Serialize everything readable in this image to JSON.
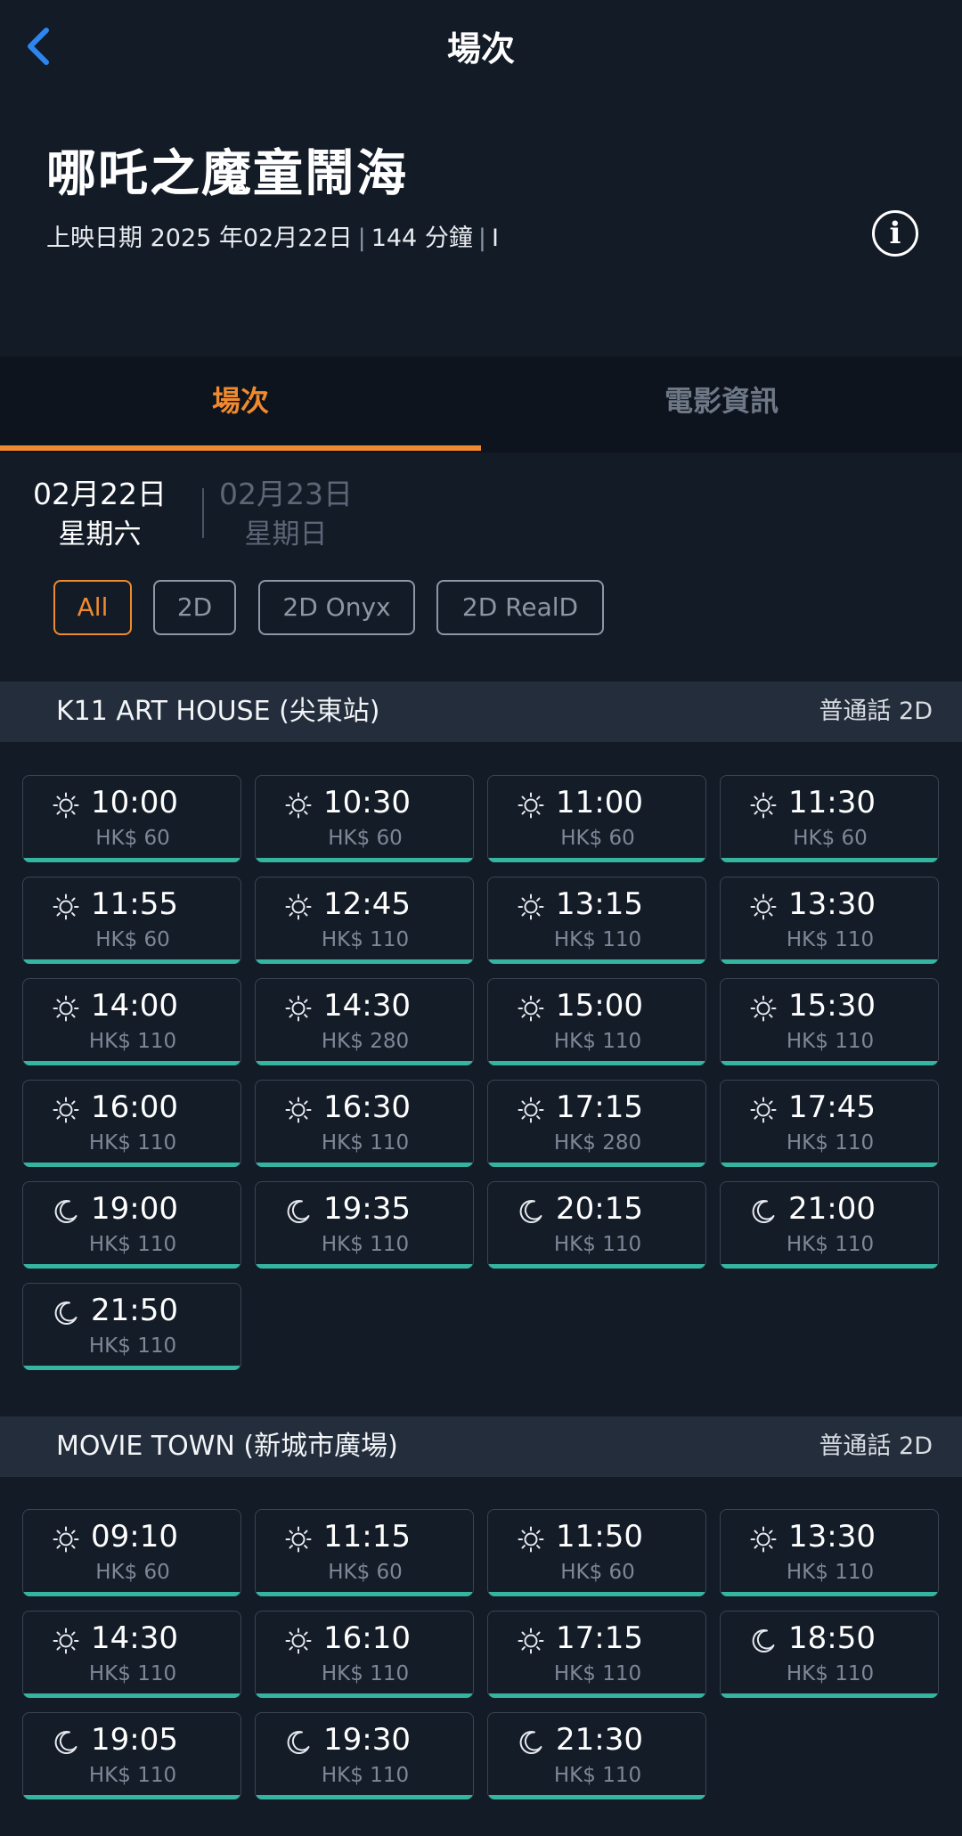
{
  "nav": {
    "title": "場次"
  },
  "movie": {
    "title": "哪吒之魔童鬧海",
    "release": "上映日期 2025 年02月22日",
    "duration": "144 分鐘",
    "rating": "I"
  },
  "tabs": [
    {
      "label": "場次"
    },
    {
      "label": "電影資訊"
    }
  ],
  "dates": [
    {
      "date": "02月22日",
      "weekday": "星期六"
    },
    {
      "date": "02月23日",
      "weekday": "星期日"
    }
  ],
  "filters": [
    {
      "label": "All"
    },
    {
      "label": "2D"
    },
    {
      "label": "2D Onyx"
    },
    {
      "label": "2D RealD"
    }
  ],
  "cinemas": [
    {
      "name": "K11 ART HOUSE (尖東站)",
      "lang": "普通話 2D",
      "showtimes": [
        {
          "time": "10:00",
          "price": "HK$ 60",
          "icon": "sun-icon"
        },
        {
          "time": "10:30",
          "price": "HK$ 60",
          "icon": "sun-icon"
        },
        {
          "time": "11:00",
          "price": "HK$ 60",
          "icon": "sun-icon"
        },
        {
          "time": "11:30",
          "price": "HK$ 60",
          "icon": "sun-icon"
        },
        {
          "time": "11:55",
          "price": "HK$ 60",
          "icon": "sun-icon"
        },
        {
          "time": "12:45",
          "price": "HK$ 110",
          "icon": "sun-icon"
        },
        {
          "time": "13:15",
          "price": "HK$ 110",
          "icon": "sun-icon"
        },
        {
          "time": "13:30",
          "price": "HK$ 110",
          "icon": "sun-icon"
        },
        {
          "time": "14:00",
          "price": "HK$ 110",
          "icon": "sun-icon"
        },
        {
          "time": "14:30",
          "price": "HK$ 280",
          "icon": "sun-icon"
        },
        {
          "time": "15:00",
          "price": "HK$ 110",
          "icon": "sun-icon"
        },
        {
          "time": "15:30",
          "price": "HK$ 110",
          "icon": "sun-icon"
        },
        {
          "time": "16:00",
          "price": "HK$ 110",
          "icon": "sun-icon"
        },
        {
          "time": "16:30",
          "price": "HK$ 110",
          "icon": "sun-icon"
        },
        {
          "time": "17:15",
          "price": "HK$ 280",
          "icon": "sun-icon"
        },
        {
          "time": "17:45",
          "price": "HK$ 110",
          "icon": "sun-icon"
        },
        {
          "time": "19:00",
          "price": "HK$ 110",
          "icon": "moon-icon"
        },
        {
          "time": "19:35",
          "price": "HK$ 110",
          "icon": "moon-icon"
        },
        {
          "time": "20:15",
          "price": "HK$ 110",
          "icon": "moon-icon"
        },
        {
          "time": "21:00",
          "price": "HK$ 110",
          "icon": "moon-icon"
        },
        {
          "time": "21:50",
          "price": "HK$ 110",
          "icon": "moon-icon"
        }
      ]
    },
    {
      "name": "MOVIE TOWN (新城市廣場)",
      "lang": "普通話 2D",
      "showtimes": [
        {
          "time": "09:10",
          "price": "HK$ 60",
          "icon": "sun-icon"
        },
        {
          "time": "11:15",
          "price": "HK$ 60",
          "icon": "sun-icon"
        },
        {
          "time": "11:50",
          "price": "HK$ 60",
          "icon": "sun-icon"
        },
        {
          "time": "13:30",
          "price": "HK$ 110",
          "icon": "sun-icon"
        },
        {
          "time": "14:30",
          "price": "HK$ 110",
          "icon": "sun-icon"
        },
        {
          "time": "16:10",
          "price": "HK$ 110",
          "icon": "sun-icon"
        },
        {
          "time": "17:15",
          "price": "HK$ 110",
          "icon": "sun-icon"
        },
        {
          "time": "18:50",
          "price": "HK$ 110",
          "icon": "moon-icon"
        },
        {
          "time": "19:05",
          "price": "HK$ 110",
          "icon": "moon-icon"
        },
        {
          "time": "19:30",
          "price": "HK$ 110",
          "icon": "moon-icon"
        },
        {
          "time": "21:30",
          "price": "HK$ 110",
          "icon": "moon-icon"
        }
      ]
    }
  ],
  "colors": {
    "accent": "#f08a2e",
    "availability_bar": "#35b59f",
    "background": "#131b27"
  }
}
